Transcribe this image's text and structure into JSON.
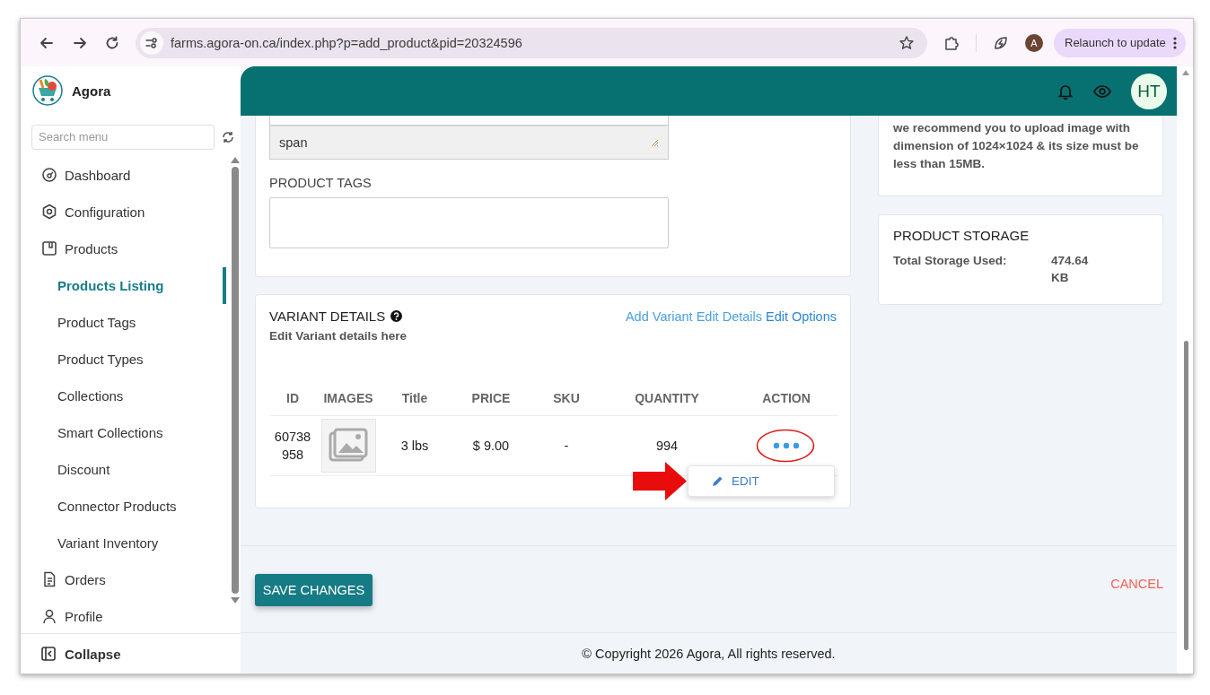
{
  "browser": {
    "url": "farms.agora-on.ca/index.php?p=add_product&pid=20324596",
    "profile_initial": "A",
    "relaunch": "Relaunch to update"
  },
  "sidebar": {
    "brand": "Agora",
    "search": {
      "placeholder": "Search menu"
    },
    "items": [
      {
        "label": "Dashboard",
        "kind": "dashboard",
        "selected": false
      },
      {
        "label": "Configuration",
        "kind": "configuration",
        "selected": false
      },
      {
        "label": "Products",
        "kind": "products",
        "selected": false,
        "children": [
          {
            "label": "Products Listing",
            "selected": true
          },
          {
            "label": "Product Tags",
            "selected": false
          },
          {
            "label": "Product Types",
            "selected": false
          },
          {
            "label": "Collections",
            "selected": false
          },
          {
            "label": "Smart Collections",
            "selected": false
          },
          {
            "label": "Discount",
            "selected": false
          },
          {
            "label": "Connector Products",
            "selected": false
          },
          {
            "label": "Variant Inventory",
            "selected": false
          }
        ]
      },
      {
        "label": "Orders",
        "kind": "orders",
        "selected": false
      },
      {
        "label": "Profile",
        "kind": "profile",
        "selected": false
      }
    ],
    "collapse": "Collapse"
  },
  "header": {
    "avatar": "HT"
  },
  "product_form": {
    "description": {
      "value": "span"
    },
    "tags": {
      "label": "PRODUCT TAGS"
    }
  },
  "variants": {
    "title": "VARIANT DETAILS",
    "subtitle": "Edit Variant details here",
    "links": [
      "Add Variant",
      "Edit Details",
      "Edit Options"
    ],
    "columns": [
      "ID",
      "IMAGES",
      "Title",
      "PRICE",
      "SKU",
      "QUANTITY",
      "ACTION"
    ],
    "rows": [
      {
        "id": "60738958",
        "title": "3 lbs",
        "price": "$ 9.00",
        "sku": "-",
        "quantity": "994"
      }
    ],
    "action_menu": {
      "items": [
        "EDIT"
      ]
    },
    "annotations": [
      {
        "kind": "ellipse"
      },
      {
        "kind": "arrow"
      }
    ]
  },
  "image_note": "we recommend you to upload image with dimension of 1024×1024 & its size must be less than 15MB.",
  "storage": {
    "title": "PRODUCT STORAGE",
    "label": "Total Storage Used:",
    "value": "474.64 KB"
  },
  "actions": {
    "save": "SAVE CHANGES",
    "cancel": "CANCEL"
  },
  "footer": "© Copyright 2026 Agora, All rights reserved."
}
